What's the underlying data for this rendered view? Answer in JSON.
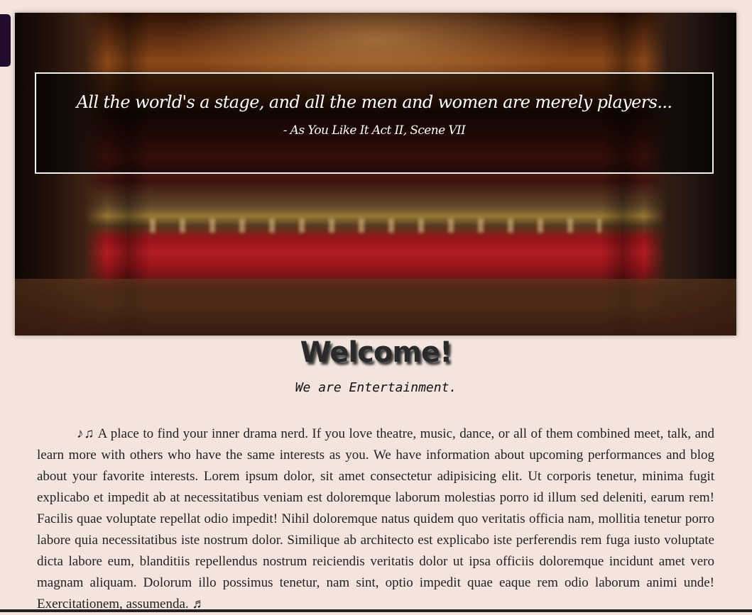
{
  "hero": {
    "quote": "All the world's a stage, and all the men and women are merely players...",
    "source": "- As You Like It Act II, Scene VII"
  },
  "welcome": {
    "title": "Welcome!",
    "tagline": "We are Entertainment."
  },
  "intro": {
    "text": "♪♫  A place to find your inner drama nerd. If you love theatre, music, dance, or all of them combined meet, talk, and learn more with others who have the same interests as you. We have information about upcoming performances and blog about your favorite interests. Lorem ipsum dolor, sit amet consectetur adipisicing elit. Ut corporis tenetur, minima fugit explicabo et impedit ab at necessitatibus veniam est doloremque laborum molestias porro id illum sed deleniti, earum rem! Facilis quae voluptate repellat odio impedit! Nihil doloremque natus quidem quo veritatis officia nam, mollitia tenetur porro labore quia necessitatibus iste nostrum dolor. Similique ab architecto est explicabo iste perferendis rem fuga iusto voluptate dicta labore eum, blanditiis repellendus nostrum reiciendis veritatis dolor ut ipsa officiis doloremque incidunt amet vero magnam aliquam. Dolorum illo possimus tenetur, nam sint, optio impedit quae eaque rem odio laborum animi unde! Exercitationem, assumenda. ♬"
  },
  "colors": {
    "background": "#f3e5dd",
    "side_tab": "#240c2e",
    "quote_border": "#f1f1f1"
  }
}
